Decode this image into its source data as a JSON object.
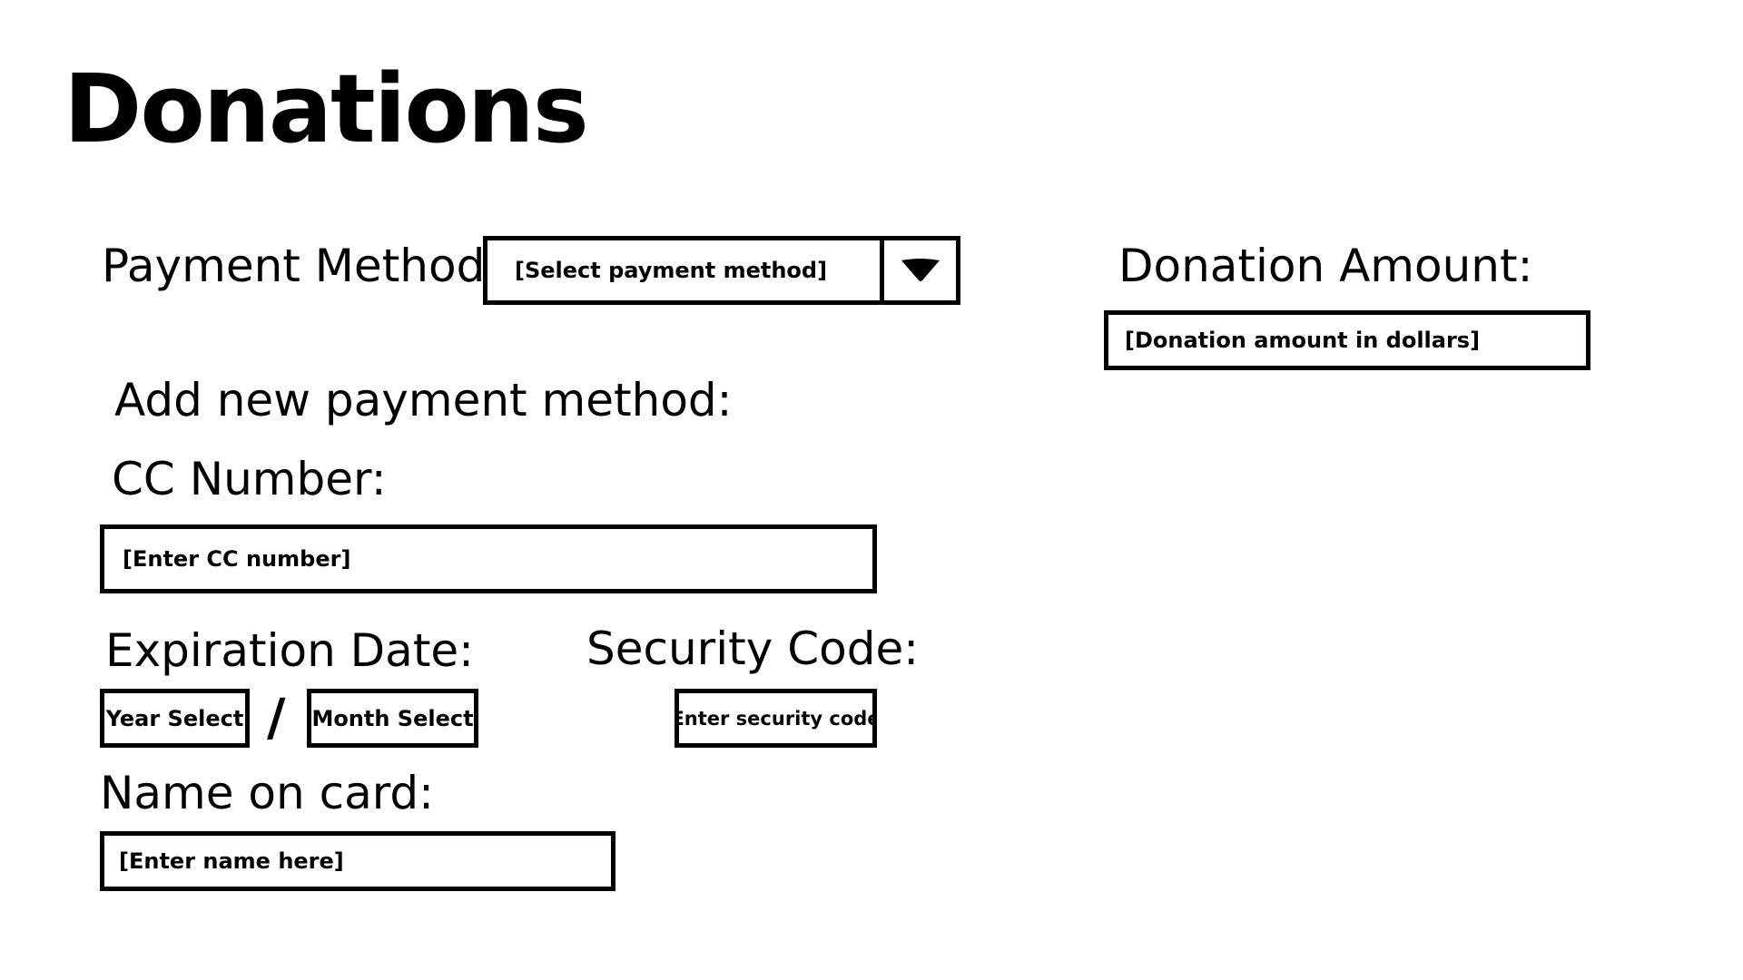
{
  "page": {
    "title": "Donations"
  },
  "payment_method": {
    "label": "Payment Method:",
    "select_placeholder": "[Select payment method]",
    "toggle_icon": "caret-down-icon"
  },
  "donation": {
    "label": "Donation Amount:",
    "input_placeholder": "[Donation amount in dollars]"
  },
  "new_method": {
    "heading": "Add new payment method:",
    "cc_label": "CC Number:",
    "cc_placeholder": "[Enter CC number]",
    "expiration_label": "Expiration Date:",
    "year_placeholder": "[Year Select]",
    "separator": "/",
    "month_placeholder": "[Month Select]",
    "security_label": "Security Code:",
    "security_placeholder": "[Enter security code]",
    "name_label": "Name on card:",
    "name_placeholder": "[Enter name here]"
  }
}
